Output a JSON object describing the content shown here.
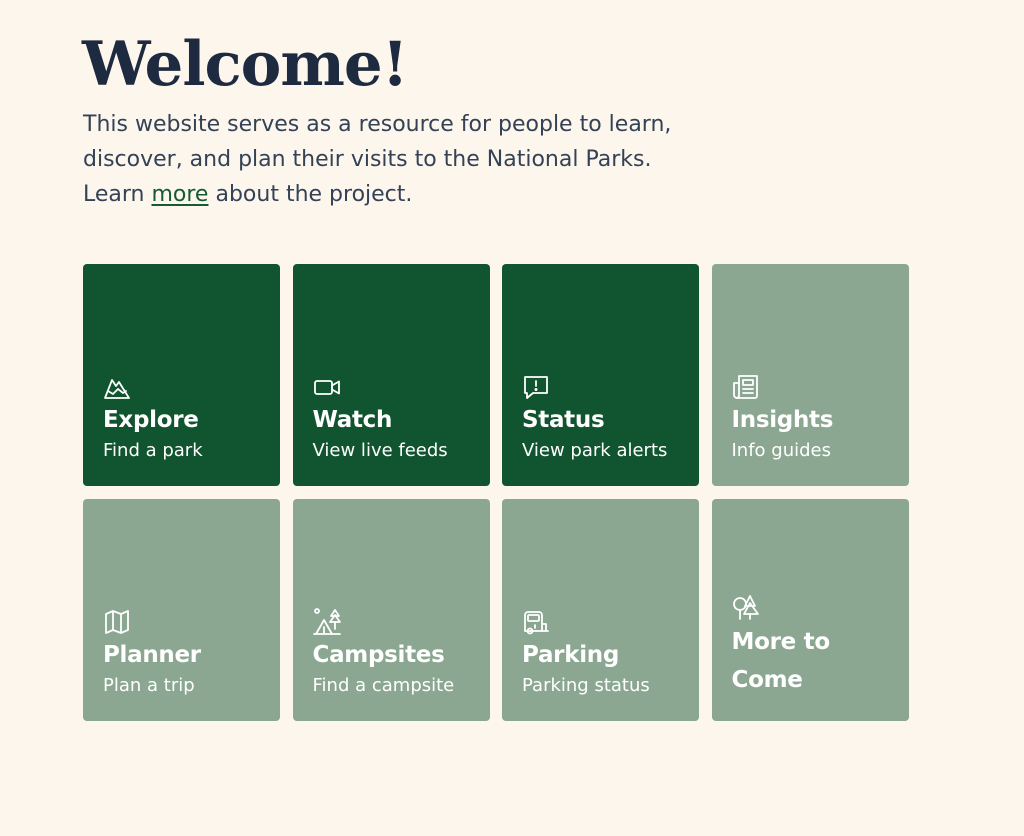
{
  "header": {
    "title": "Welcome!",
    "intro_line1": "This website serves as a resource for people to learn,",
    "intro_line2": "discover, and plan their visits to the National Parks.",
    "intro_prefix": "Learn ",
    "intro_link": "more",
    "intro_suffix": " about the project."
  },
  "colors": {
    "background": "#fdf6ec",
    "card_active": "#115430",
    "card_inactive": "#8ba791",
    "title": "#1e2a3f",
    "link": "#155a31"
  },
  "cards": [
    {
      "title": "Explore",
      "subtitle": "Find a park",
      "icon": "mountain-icon",
      "active": true
    },
    {
      "title": "Watch",
      "subtitle": "View live feeds",
      "icon": "video-camera-icon",
      "active": true
    },
    {
      "title": "Status",
      "subtitle": "View park alerts",
      "icon": "alert-message-icon",
      "active": true
    },
    {
      "title": "Insights",
      "subtitle": "Info guides",
      "icon": "newspaper-icon",
      "active": false
    },
    {
      "title": "Planner",
      "subtitle": "Plan a trip",
      "icon": "map-icon",
      "active": false
    },
    {
      "title": "Campsites",
      "subtitle": "Find a campsite",
      "icon": "camping-tent-icon",
      "active": false
    },
    {
      "title": "Parking",
      "subtitle": "Parking status",
      "icon": "camper-van-icon",
      "active": false
    },
    {
      "title_line1": "More to",
      "title_line2": "Come",
      "icon": "trees-icon",
      "active": false
    }
  ]
}
